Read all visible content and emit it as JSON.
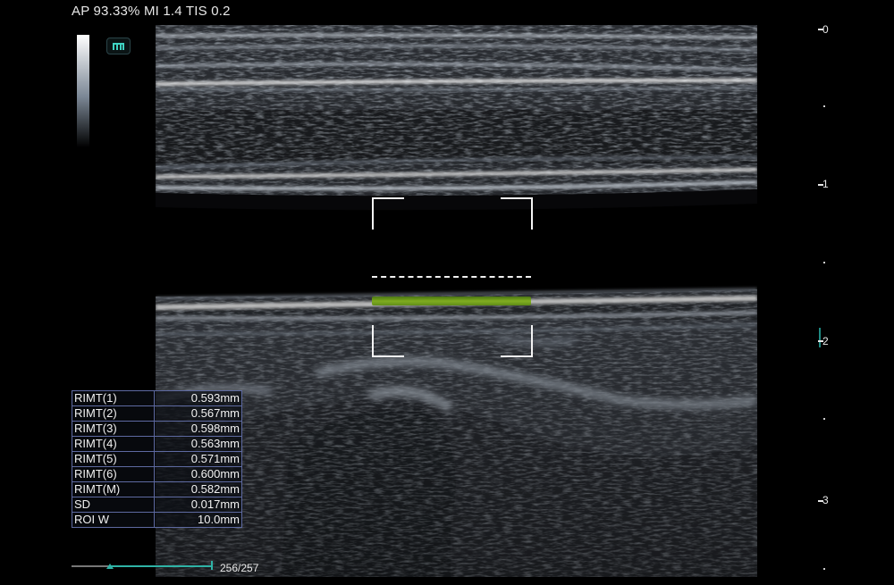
{
  "header": {
    "status": "AP 93.33%  MI 1.4 TIS 0.2"
  },
  "logo": {
    "glyph": "m"
  },
  "depth_scale": {
    "labels": [
      "0",
      "1",
      "2",
      "3"
    ]
  },
  "results": [
    {
      "label": "RIMT(1)",
      "value": "0.593mm"
    },
    {
      "label": "RIMT(2)",
      "value": "0.567mm"
    },
    {
      "label": "RIMT(3)",
      "value": "0.598mm"
    },
    {
      "label": "RIMT(4)",
      "value": "0.563mm"
    },
    {
      "label": "RIMT(5)",
      "value": "0.571mm"
    },
    {
      "label": "RIMT(6)",
      "value": "0.600mm"
    },
    {
      "label": "RIMT(M)",
      "value": "0.582mm"
    },
    {
      "label": "SD",
      "value": "0.017mm"
    },
    {
      "label": "ROI W",
      "value": "10.0mm"
    }
  ],
  "cine": {
    "frame_counter": "256/257"
  },
  "colors": {
    "trace": "#7fae1a",
    "accent": "#2fb3a6",
    "table_border": "#5e6aa1"
  }
}
